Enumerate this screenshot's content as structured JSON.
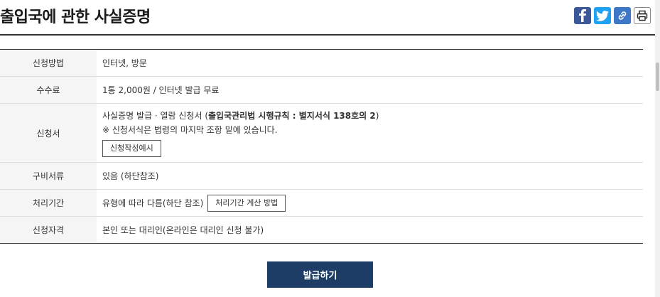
{
  "page": {
    "title": "출입국에 관한 사실증명"
  },
  "share": {
    "icons": [
      "facebook-icon",
      "twitter-icon",
      "link-icon",
      "print-icon"
    ],
    "colors": {
      "facebook": "#3b5998",
      "twitter": "#1da1f2",
      "link": "#3d78c8"
    }
  },
  "table": {
    "method": {
      "label": "신청방법",
      "value": "인터넷, 방문"
    },
    "fee": {
      "label": "수수료",
      "value": "1통 2,000원 / 인터넷 발급 무료"
    },
    "form": {
      "label": "신청서",
      "line1_prefix": "사실증명 발급 · 열람 신청서 (",
      "line1_bold": "출입국관리법 시행규칙 : 별지서식 138호의 2",
      "line1_suffix": ")",
      "line2": "※ 신청서식은 법령의 마지막 조항 밑에 있습니다.",
      "example_button": "신청작성예시"
    },
    "documents": {
      "label": "구비서류",
      "value": "있음 (하단참조)"
    },
    "period": {
      "label": "처리기간",
      "value": "유형에 따라 다름(하단 참조)",
      "calc_button": "처리기간 계산 방법"
    },
    "eligibility": {
      "label": "신청자격",
      "value": "본인 또는 대리인(온라인은 대리인 신청 불가)"
    }
  },
  "actions": {
    "issue": "발급하기",
    "issue_color": "#1d3d66"
  }
}
